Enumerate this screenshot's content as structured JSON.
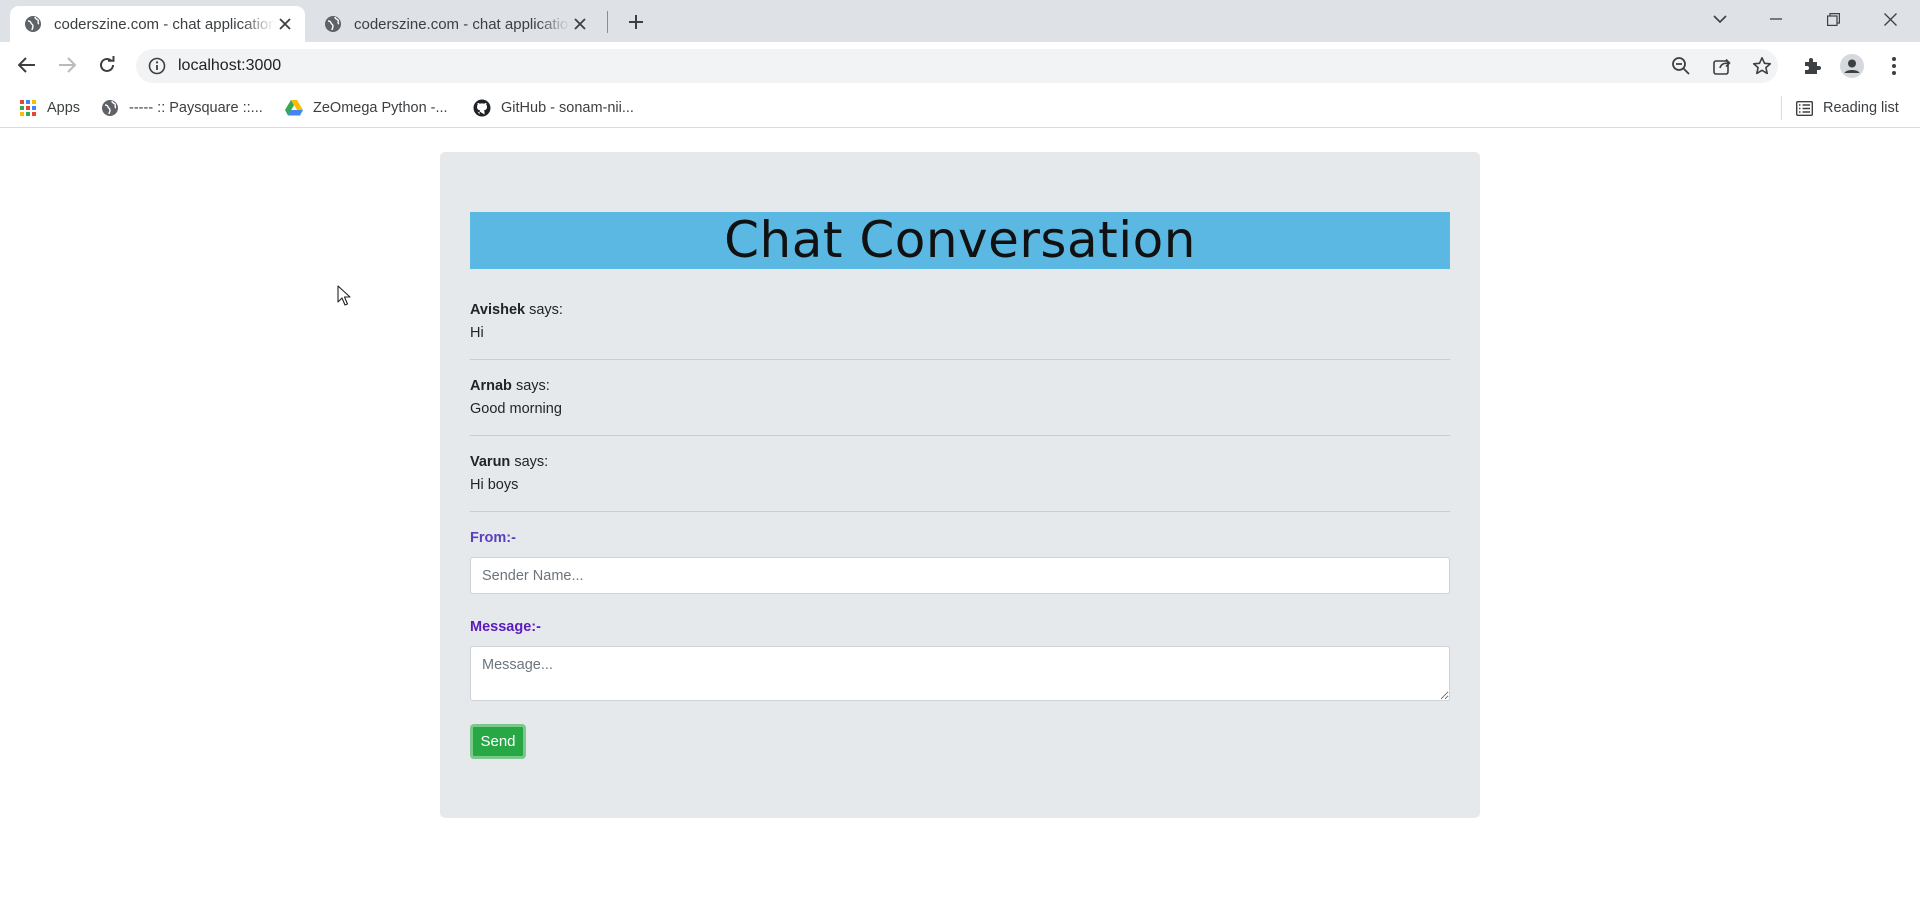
{
  "browser": {
    "tabs": [
      {
        "title": "coderszine.com - chat application",
        "active": true
      },
      {
        "title": "coderszine.com - chat application",
        "active": false
      }
    ],
    "address": "localhost:3000",
    "bookmarks": [
      {
        "label": "Apps"
      },
      {
        "label": "----- :: Paysquare ::..."
      },
      {
        "label": "ZeOmega Python -..."
      },
      {
        "label": "GitHub - sonam-nii..."
      }
    ],
    "reading_list": "Reading list"
  },
  "page": {
    "heading": "Chat Conversation",
    "says_word": "says:",
    "messages": [
      {
        "sender": "Avishek",
        "text": "Hi"
      },
      {
        "sender": "Arnab",
        "text": "Good morning"
      },
      {
        "sender": "Varun",
        "text": "Hi boys"
      }
    ],
    "form": {
      "from_label": "From:-",
      "sender_placeholder": "Sender Name...",
      "sender_value": "",
      "message_label": "Message:-",
      "message_placeholder": "Message...",
      "message_value": "",
      "send_label": "Send"
    },
    "colors": {
      "header_bg": "#5bb8e3",
      "from_label": "#5a3fc0",
      "message_label": "#5b1bbf",
      "send_button": "#28a745"
    }
  }
}
